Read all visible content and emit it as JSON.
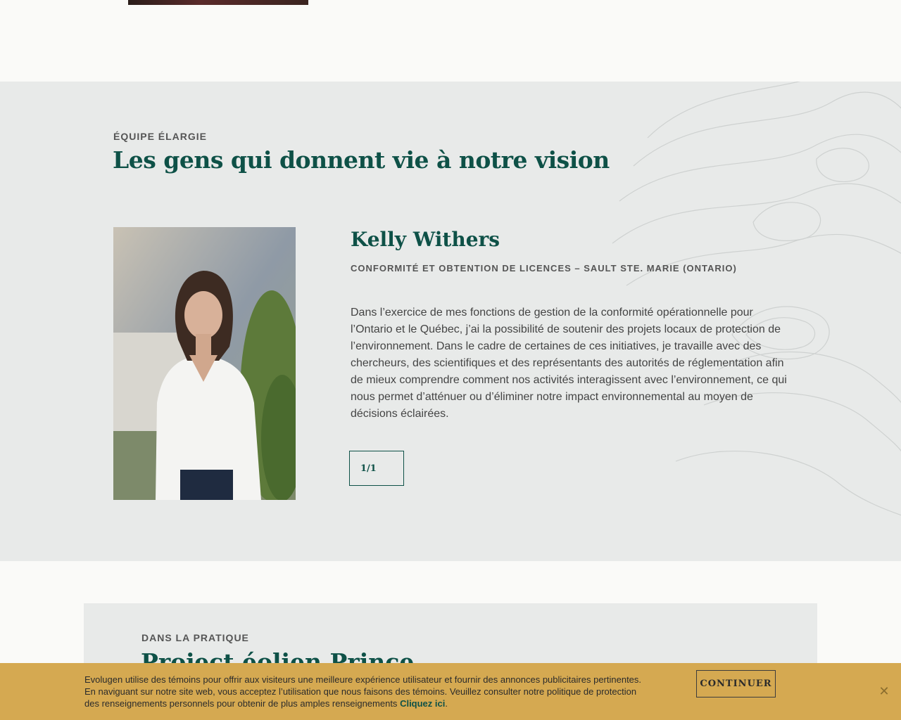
{
  "team": {
    "eyebrow": "ÉQUIPE ÉLARGIE",
    "heading": "Les gens qui donnent vie à notre vision",
    "member": {
      "name": "Kelly Withers",
      "role": "CONFORMITÉ ET OBTENTION DE LICENCES – SAULT STE. MARIE (ONTARIO)",
      "bio": "Dans l’exercice de mes fonctions de gestion de la conformité opérationnelle pour l’Ontario et le Québec, j’ai la possibilité de soutenir des projets locaux de protection de l’environnement. Dans le cadre de certaines de ces initiatives, je travaille avec des chercheurs, des scientifiques et des représentants des autorités de réglementation afin de mieux comprendre comment nos activités interagissent avec l’environnement, ce qui nous permet d’atténuer ou d’éliminer notre impact environnemental au moyen de décisions éclairées."
    },
    "pager": "1/1"
  },
  "practice": {
    "eyebrow": "DANS LA PRATIQUE",
    "heading": "Project éolien Prince"
  },
  "cookie": {
    "text": "Evolugen utilise des témoins pour offrir aux visiteurs une meilleure expérience utilisateur et fournir des annonces publicitaires pertinentes. En naviguant sur notre site web, vous acceptez l’utilisation que nous faisons des témoins. Veuillez consulter notre politique de protection des renseignements personnels pour obtenir de plus amples renseignements",
    "link": "Cliquez ici",
    "continue": "CONTINUER",
    "close": "✕"
  },
  "colors": {
    "brand_green": "#0e5147",
    "cookie_bg": "#d5a951",
    "section_bg": "#e8eae9"
  }
}
